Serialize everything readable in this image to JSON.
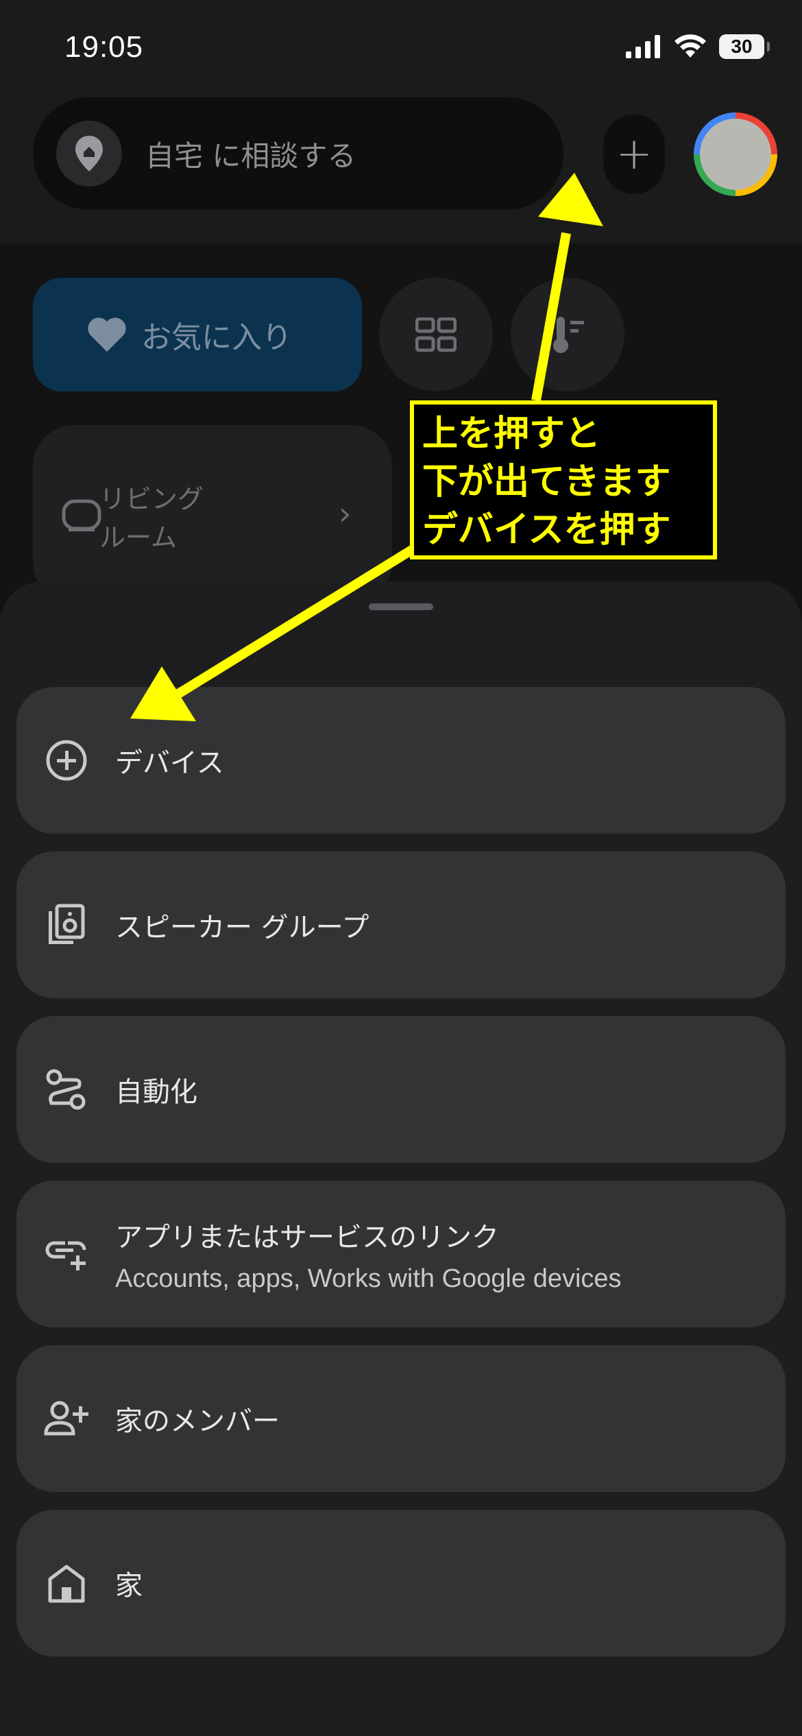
{
  "status_bar": {
    "time": "19:05",
    "battery": "30"
  },
  "header": {
    "search_placeholder": "自宅 に相談する",
    "add_label": "+"
  },
  "chips": {
    "favorites_label": "お気に入り"
  },
  "room_card": {
    "label_line1": "リビング",
    "label_line2": "ルーム"
  },
  "menu": {
    "items": [
      {
        "label": "デバイス",
        "icon": "add-circle-icon"
      },
      {
        "label": "スピーカー グループ",
        "icon": "speaker-group-icon"
      },
      {
        "label": "自動化",
        "icon": "automation-icon"
      },
      {
        "label": "アプリまたはサービスのリンク",
        "sublabel": "Accounts, apps, Works with Google devices",
        "icon": "link-add-icon"
      },
      {
        "label": "家のメンバー",
        "icon": "person-add-icon"
      },
      {
        "label": "家",
        "icon": "home-icon"
      }
    ]
  },
  "annotation": {
    "line1": "上を押すと",
    "line2": "下が出てきます",
    "line3": "デバイスを押す",
    "color": "#ffff00"
  }
}
